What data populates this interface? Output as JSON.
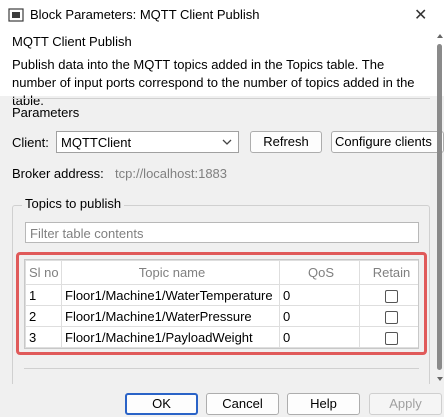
{
  "window": {
    "title": "Block Parameters: MQTT Client Publish",
    "icon": "simulink-block-icon",
    "close_glyph": "✕"
  },
  "block": {
    "name": "MQTT Client Publish",
    "description": "Publish data into the MQTT topics added in the Topics table. The number of input ports correspond to the number of topics added in the table."
  },
  "parameters": {
    "section_label": "Parameters",
    "client_label": "Client:",
    "client_value": "MQTTClient",
    "refresh_label": "Refresh",
    "configure_label": "Configure clients",
    "broker_label": "Broker address:",
    "broker_value": "tcp://localhost:1883"
  },
  "topics": {
    "group_label": "Topics to publish",
    "filter_placeholder": "Filter table contents",
    "columns": [
      "Sl no",
      "Topic name",
      "QoS",
      "Retain"
    ],
    "rows": [
      {
        "sl": "1",
        "topic": "Floor1/Machine1/WaterTemperature",
        "qos": "0",
        "retain": false
      },
      {
        "sl": "2",
        "topic": "Floor1/Machine1/WaterPressure",
        "qos": "0",
        "retain": false
      },
      {
        "sl": "3",
        "topic": "Floor1/Machine1/PayloadWeight",
        "qos": "0",
        "retain": false
      }
    ]
  },
  "buttons": {
    "ok": "OK",
    "cancel": "Cancel",
    "help": "Help",
    "apply": "Apply"
  },
  "colors": {
    "highlight": "#e05a5a",
    "default_button_border": "#2a63c7"
  }
}
